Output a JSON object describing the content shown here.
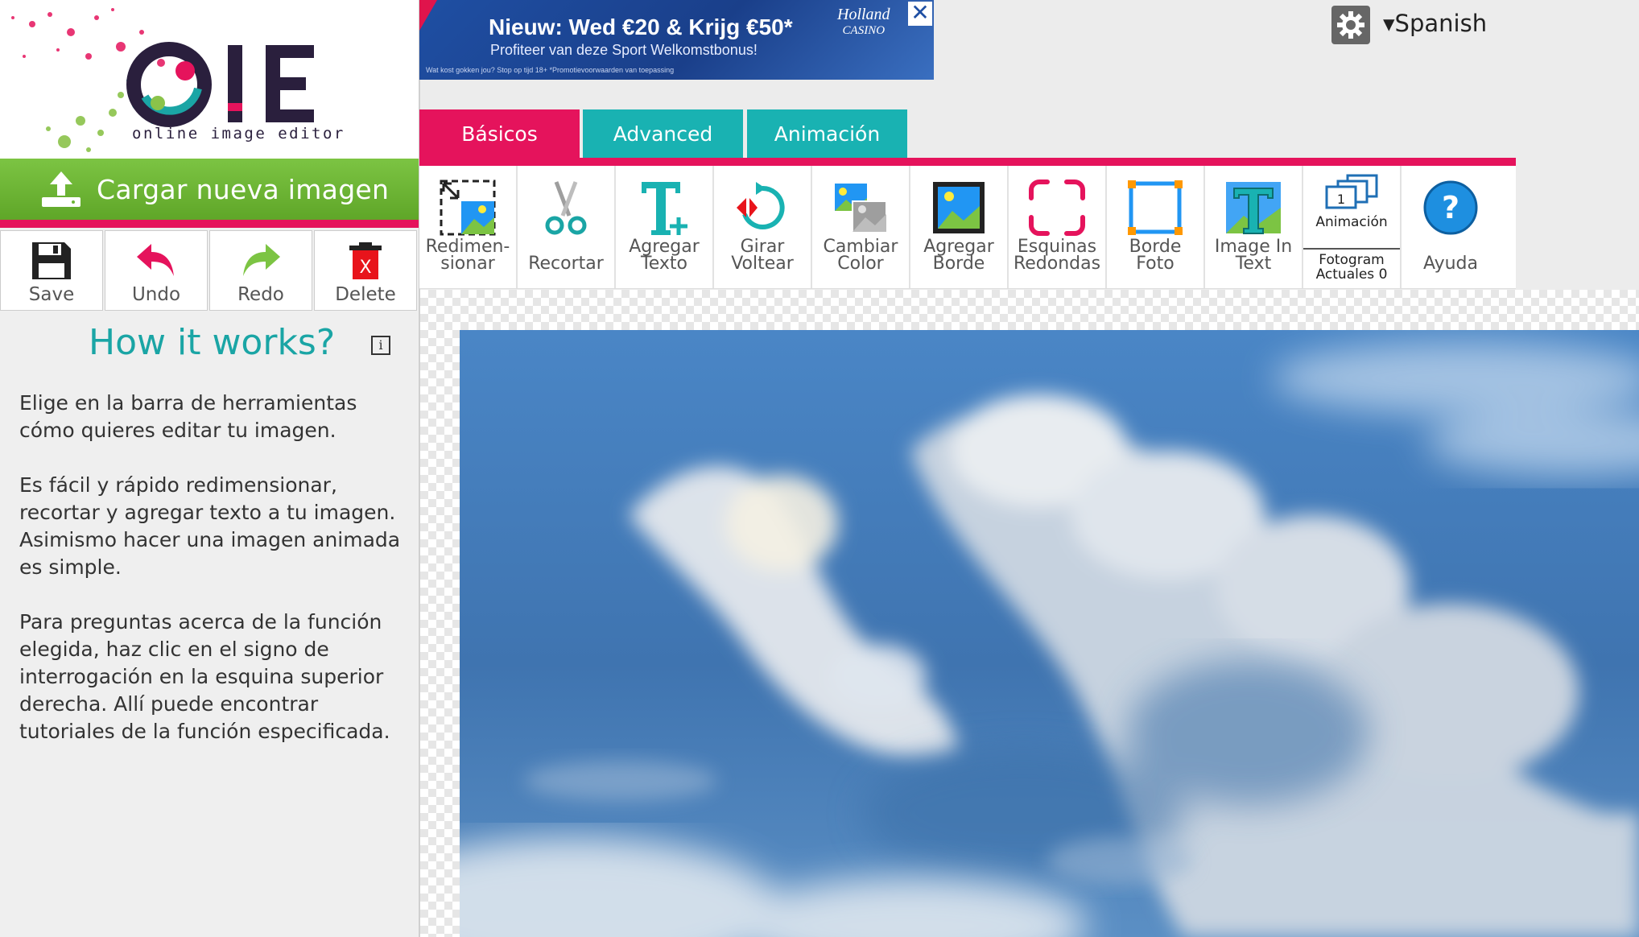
{
  "logo": {
    "text": "OIE",
    "tagline": "online image editor"
  },
  "upload": {
    "label": "Cargar nueva imagen"
  },
  "actions": [
    {
      "label": "Save",
      "icon": "save-icon"
    },
    {
      "label": "Undo",
      "icon": "undo-icon"
    },
    {
      "label": "Redo",
      "icon": "redo-icon"
    },
    {
      "label": "Delete",
      "icon": "delete-icon"
    }
  ],
  "help": {
    "title": "How it works?",
    "info_icon": "i",
    "paragraphs": [
      "Elige en la barra de herramientas cómo quieres editar tu imagen.",
      "Es fácil y rápido redimensionar, recortar y agregar texto a tu imagen. Asimismo hacer una imagen animada es simple.",
      "Para preguntas acerca de la función elegida, haz clic en el signo de interrogación en la esquina superior derecha. Allí puede encontrar tutoriales de la función especificada."
    ]
  },
  "ad": {
    "headline": "Nieuw: Wed €20 & Krijg €50*",
    "sub": "Profiteer van deze Sport Welkomstbonus!",
    "fine": "Wat kost gokken jou? Stop op tijd 18+  *Promotievoorwaarden van toepassing",
    "brand_line1": "Holland",
    "brand_line2": "CASINO",
    "close": "✕"
  },
  "header": {
    "language": "▾Spanish"
  },
  "tabs": [
    {
      "label": "Básicos"
    },
    {
      "label": "Advanced"
    },
    {
      "label": "Animación"
    }
  ],
  "tools": [
    {
      "line1": "Redimen-",
      "line2": "sionar"
    },
    {
      "line1": "",
      "line2": "Recortar"
    },
    {
      "line1": "Agregar",
      "line2": "Texto"
    },
    {
      "line1": "Girar",
      "line2": "Voltear"
    },
    {
      "line1": "Cambiar",
      "line2": "Color"
    },
    {
      "line1": "Agregar",
      "line2": "Borde"
    },
    {
      "line1": "Esquinas",
      "line2": "Redondas"
    },
    {
      "line1": "Borde",
      "line2": "Foto"
    },
    {
      "line1": "Image In",
      "line2": "Text"
    },
    {
      "line1": "",
      "line2": "Ayuda"
    }
  ],
  "animation_tool": {
    "label": "Animación",
    "frames_line1": "Fotogram",
    "frames_line2": "Actuales 0",
    "stack_number": "1"
  },
  "colors": {
    "accent_pink": "#e5135c",
    "tab_teal": "#19b2b2",
    "upload_green": "#6db535",
    "title_teal": "#1aa5a5"
  }
}
